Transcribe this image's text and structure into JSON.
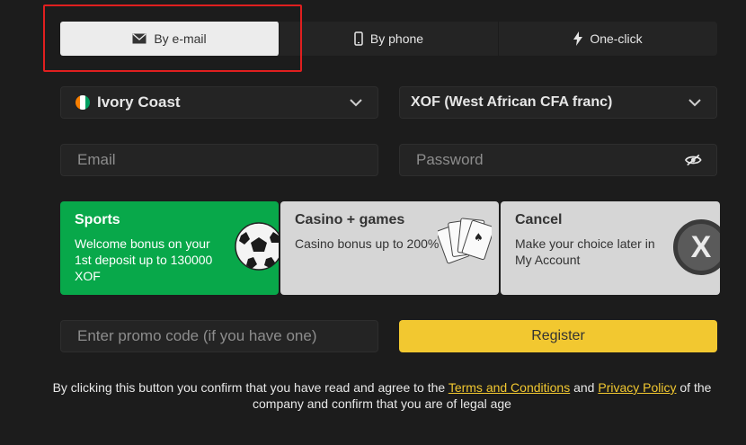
{
  "tabs": [
    {
      "label": "By e-mail",
      "icon": "envelope-icon",
      "active": true
    },
    {
      "label": "By phone",
      "icon": "phone-icon",
      "active": false
    },
    {
      "label": "One-click",
      "icon": "lightning-icon",
      "active": false
    }
  ],
  "country": {
    "value": "Ivory Coast",
    "flag_colors": [
      "#f77f00",
      "#ffffff",
      "#009e60"
    ]
  },
  "currency": {
    "value": "XOF (West African CFA franc)"
  },
  "email": {
    "placeholder": "Email"
  },
  "password": {
    "placeholder": "Password"
  },
  "bonuses": {
    "sports": {
      "title": "Sports",
      "text": "Welcome bonus on your 1st deposit up to 130000 XOF"
    },
    "casino": {
      "title": "Casino + games",
      "text": "Casino bonus up to 200%"
    },
    "cancel": {
      "title": "Cancel",
      "text": "Make your choice later in My Account",
      "badge": "X"
    }
  },
  "promo": {
    "placeholder": "Enter promo code (if you have one)"
  },
  "register": {
    "label": "Register"
  },
  "legal": {
    "before": "By clicking this button you confirm that you have read and agree to the ",
    "terms_link": "Terms and Conditions",
    "and": " and ",
    "privacy_link": "Privacy Policy",
    "after": " of the company and confirm that you are of legal age"
  },
  "colors": {
    "accent": "#f2c830",
    "sports_green": "#08a84a",
    "highlight": "#e01f1f"
  }
}
